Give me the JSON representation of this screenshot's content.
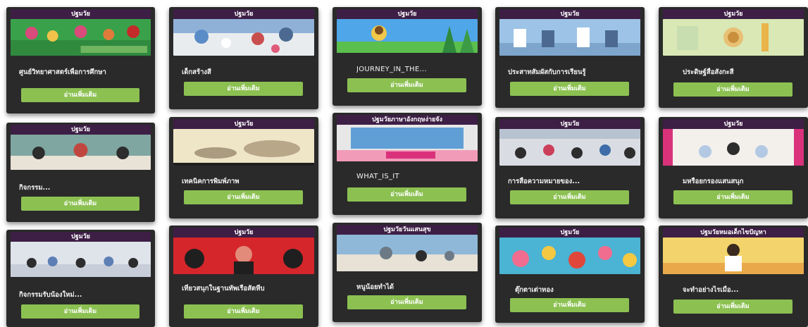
{
  "cards": [
    {
      "header": "ปฐมวัย",
      "title": "ศูนย์วิทยาศาสตร์เพื่อการศึกษา",
      "button": "อ่านเพิ่มเติม",
      "thumb_colors": [
        "#3aa14b",
        "#d94b7a",
        "#f0c24a"
      ]
    },
    {
      "header": "ปฐมวัย",
      "title": "เด็กสร้างสี",
      "button": "อ่านเพิ่มเติม",
      "thumb_colors": [
        "#e9ecef",
        "#5a8cc7",
        "#c94f4f"
      ]
    },
    {
      "header": "ปฐมวัย",
      "title": "JOURNEY_IN_THE...",
      "button": "อ่านเพิ่มเติม",
      "thumb_colors": [
        "#4fa6e8",
        "#f2c84a",
        "#5bbf4d"
      ]
    },
    {
      "header": "ปฐมวัย",
      "title": "ประสาทสัมผัสกับการเรียนรู้",
      "button": "อ่านเพิ่มเติม",
      "thumb_colors": [
        "#9dc3e6",
        "#ffffff",
        "#4c6a91"
      ]
    },
    {
      "header": "ปฐมวัย",
      "title": "ประดิษฐ์สื่อสังกะสี",
      "button": "อ่านเพิ่มเติม",
      "thumb_colors": [
        "#d9e8b5",
        "#e8c074",
        "#c9deb0"
      ]
    },
    {
      "header": "ปฐมวัย",
      "title": "กิจกรรม...",
      "button": "อ่านเพิ่มเติม",
      "thumb_colors": [
        "#7fa6a0",
        "#e9e2d6",
        "#c0473f"
      ]
    },
    {
      "header": "ปฐมวัย",
      "title": "เทคนิคการพิมพ์ภาพ",
      "button": "อ่านเพิ่มเติม",
      "thumb_colors": [
        "#efe6c7",
        "#b9a78a",
        "#8d7b64"
      ]
    },
    {
      "header": "ปฐมวัยภาษาอังกฤษง่ายจัง",
      "title": "WHAT_IS_IT",
      "button": "อ่านเพิ่มเติม",
      "thumb_colors": [
        "#5f9fd6",
        "#f29bb8",
        "#e7e7e7"
      ]
    },
    {
      "header": "ปฐมวัย",
      "title": "การสื่อความหมายของ...",
      "button": "อ่านเพิ่มเติม",
      "thumb_colors": [
        "#d9dde3",
        "#cc3f5a",
        "#3e6ca8"
      ]
    },
    {
      "header": "ปฐมวัย",
      "title": "มหรือยกรองแสนสนุก",
      "button": "อ่านเพิ่มเติม",
      "thumb_colors": [
        "#f3f0ec",
        "#d9327b",
        "#b3c9e3"
      ]
    },
    {
      "header": "ปฐมวัย",
      "title": "กิจกรรมรับน้องใหม่...",
      "button": "อ่านเพิ่มเติม",
      "thumb_colors": [
        "#dfe3ea",
        "#5d7fb5",
        "#2d2d2d"
      ]
    },
    {
      "header": "ปฐมวัย",
      "title": "เที่ยวสนุกในฐานทัพเรือสัตหีบ",
      "button": "อ่านเพิ่มเติม",
      "thumb_colors": [
        "#d5262b",
        "#1f1f1f",
        "#e28b7a"
      ]
    },
    {
      "header": "ปฐมวัยวันแสนสุข",
      "title": "หนูน้อยทำได้",
      "button": "อ่านเพิ่มเติม",
      "thumb_colors": [
        "#8fb8d8",
        "#e7e1d6",
        "#6d7a86"
      ]
    },
    {
      "header": "ปฐมวัย",
      "title": "ตุ๊กตาเต่าทอง",
      "button": "อ่านเพิ่มเติม",
      "thumb_colors": [
        "#f06d8f",
        "#4bb3d3",
        "#f5c842"
      ]
    },
    {
      "header": "ปฐมวัยหมอเด็กไขปัญหา",
      "title": "จะทำอย่างไรเมื่อ...",
      "button": "อ่านเพิ่มเติม",
      "thumb_colors": [
        "#f3d36b",
        "#ffffff",
        "#e9a94b"
      ]
    }
  ]
}
